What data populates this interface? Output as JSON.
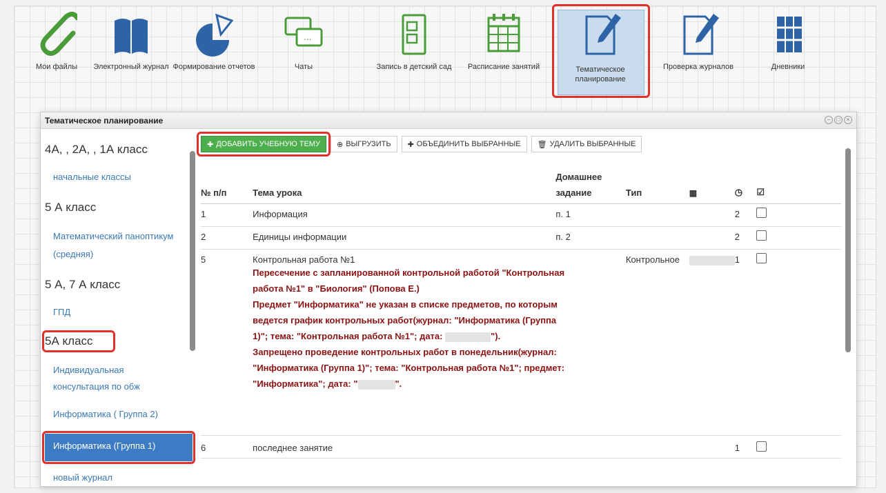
{
  "launcher": {
    "tiles": [
      {
        "label": "Мои файлы",
        "icon": "paperclip-icon"
      },
      {
        "label": "Электронный журнал",
        "icon": "book-icon"
      },
      {
        "label": "Формирование отчетов",
        "icon": "pie-chart-icon"
      },
      {
        "label": "Чаты",
        "icon": "chat-icon"
      },
      {
        "label": "Запись в детский сад",
        "icon": "document-check-icon"
      },
      {
        "label": "Расписание занятий",
        "icon": "calendar-icon"
      },
      {
        "label": "Тематическое планирование",
        "icon": "pencil-document-icon"
      },
      {
        "label": "Проверка журналов",
        "icon": "pencil-document-icon"
      },
      {
        "label": "Дневники",
        "icon": "books-icon"
      }
    ],
    "active_index": 6
  },
  "dialog": {
    "title": "Тематическое планирование"
  },
  "sidebar": {
    "groups": [
      {
        "heading": "4А, , 2А, , 1А класс",
        "items": [
          "начальные классы"
        ]
      },
      {
        "heading": "5 А класс",
        "items": [
          "Математический паноптикум",
          "(средняя)"
        ]
      },
      {
        "heading": "5 А, 7 А класс",
        "items": [
          "ГПД"
        ]
      },
      {
        "heading": "5А класс",
        "items": [
          "Индивидуальная",
          "консультация по обж",
          "Информатика ( Группа 2)",
          "Информатика (Группа 1)",
          "новый журнал"
        ]
      }
    ],
    "selected": "Информатика (Группа 1)"
  },
  "toolbar": {
    "add_label": "ДОБАВИТЬ УЧЕБНУЮ ТЕМУ",
    "export_label": "ВЫГРУЗИТЬ",
    "merge_label": "ОБЪЕДИНИТЬ ВЫБРАННЫЕ",
    "delete_label": "УДАЛИТЬ ВЫБРАННЫЕ"
  },
  "table": {
    "headers": {
      "num": "№ п/п",
      "topic": "Тема урока",
      "homework_1": "Домашнее",
      "homework_2": "задание",
      "type": "Тип"
    },
    "rows": [
      {
        "num": "1",
        "topic": "Информация",
        "homework": "п. 1",
        "type": "",
        "hours": "2"
      },
      {
        "num": "2",
        "topic": "Единицы информации",
        "homework": "п. 2",
        "type": "",
        "hours": "2"
      },
      {
        "num": "5",
        "topic": "Контрольная работа №1",
        "homework": "",
        "type": "Контрольное",
        "hours": "1"
      },
      {
        "num": "6",
        "topic": "последнее занятие",
        "homework": "",
        "type": "",
        "hours": "1"
      }
    ],
    "warnings": {
      "w1a": "Пересечение с запланированной контрольной работой \"Контрольная",
      "w1b": "работа №1\" в \"Биология\" (Попова Е.)",
      "w2a": "Предмет \"Информатика\" не указан в списке предметов, по которым",
      "w2b": "ведется график контрольных работ(журнал: \"Информатика (Группа",
      "w2c": "1)\"; тема: \"Контрольная работа №1\"; дата:",
      "w2d": "\").",
      "w3a": "Запрещено проведение контрольных работ в понедельник(журнал:",
      "w3b": "\"Информатика (Группа 1)\"; тема: \"Контрольная работа №1\"; предмет:",
      "w3c": "\"Информатика\"; дата: \"",
      "w3d": "\"."
    }
  }
}
